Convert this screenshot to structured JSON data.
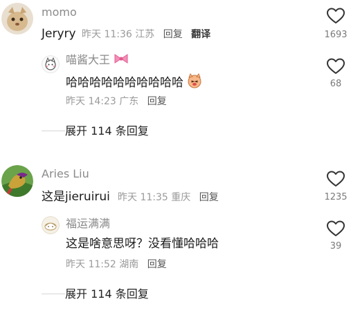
{
  "comments": [
    {
      "username": "momo",
      "text": "Jeryry",
      "time": "昨天 11:36",
      "location": "江苏",
      "reply_label": "回复",
      "translate_label": "翻译",
      "likes": "1693",
      "reply": {
        "username": "喵酱大王",
        "text": "哈哈哈哈哈哈哈哈哈哈",
        "time": "昨天 14:23",
        "location": "广东",
        "reply_label": "回复",
        "likes": "68"
      },
      "expand_label": "展开 114 条回复"
    },
    {
      "username": "Aries Liu",
      "text": "这是jieruirui",
      "time": "昨天 11:35",
      "location": "重庆",
      "reply_label": "回复",
      "likes": "1235",
      "reply": {
        "username": "福运满满",
        "text": "这是啥意思呀？没看懂哈哈哈",
        "time": "昨天 11:52",
        "location": "湖南",
        "reply_label": "回复",
        "likes": "39"
      },
      "expand_label": "展开 114 条回复"
    }
  ],
  "colors": {
    "username": "#8a8a8a",
    "text": "#1a1a1a",
    "meta": "#9a9a9a",
    "like_outline": "#333333",
    "bow": "#f06aa0"
  }
}
